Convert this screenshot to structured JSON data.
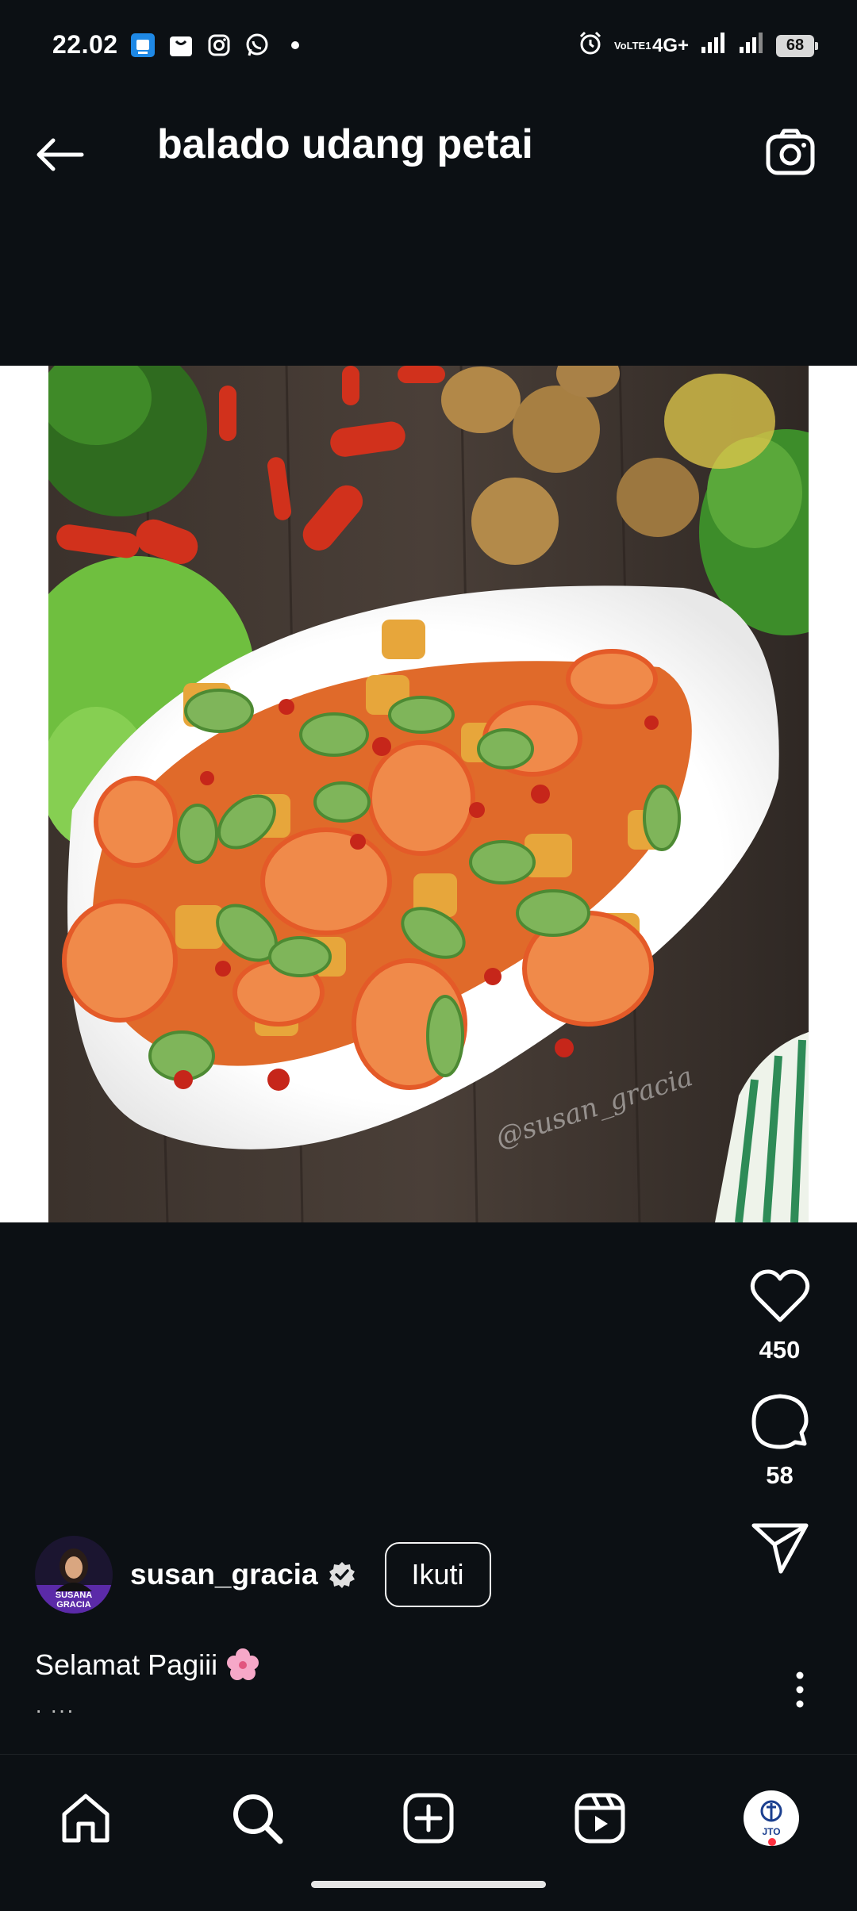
{
  "status_bar": {
    "time": "22.02",
    "network": "4G+",
    "volte": "VoLTE1",
    "battery": "68"
  },
  "header": {
    "title": "balado udang petai"
  },
  "photo": {
    "watermark": "@susan_gracia"
  },
  "actions": {
    "likes": "450",
    "comments": "58"
  },
  "author": {
    "username": "susan_gracia",
    "avatar_text": "SUSANA GRACIA",
    "follow_label": "Ikuti"
  },
  "caption": {
    "text": "Selamat Pagiii",
    "more": "· ···"
  },
  "nav": {
    "profile_badge": "JTO"
  },
  "colors": {
    "background": "#0c1014",
    "text": "#ffffff",
    "notification": "#ff3040"
  }
}
